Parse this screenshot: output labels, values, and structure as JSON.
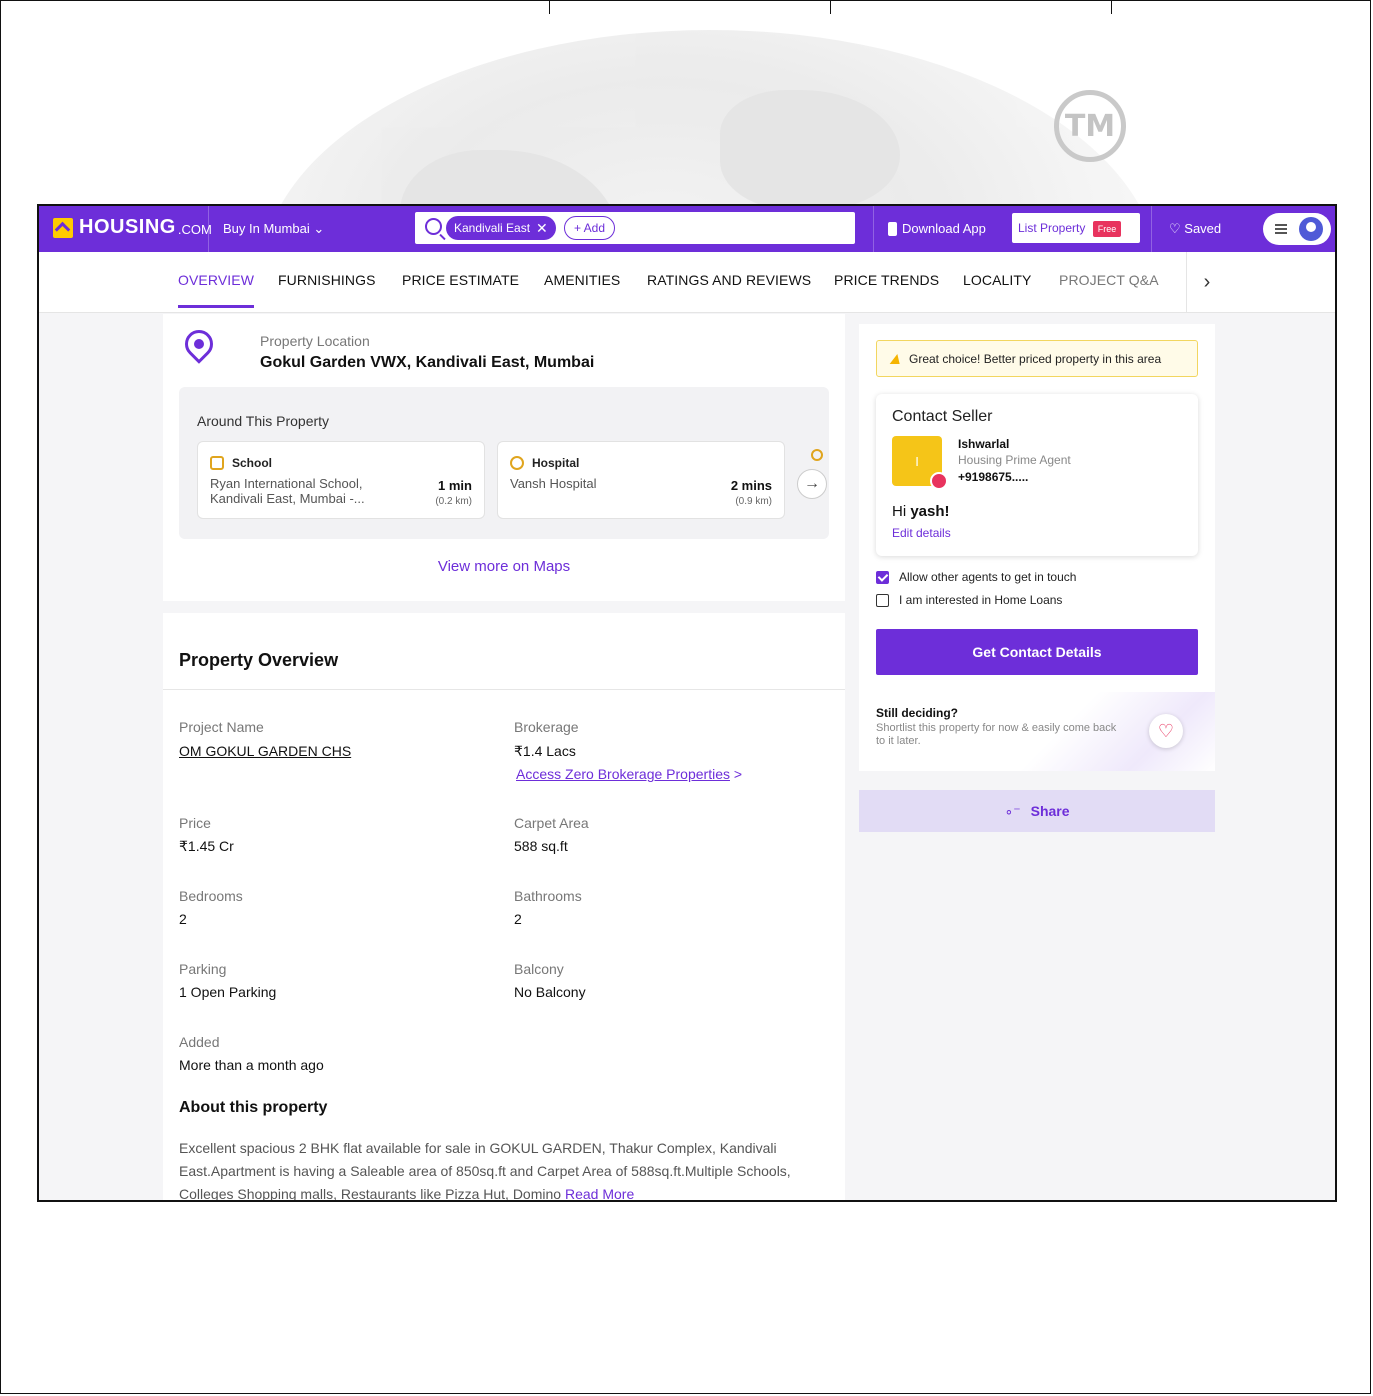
{
  "header": {
    "logo_text": "HOUSING",
    "logo_suffix": ".COM",
    "buy_menu": "Buy In Mumbai",
    "search_chip": "Kandivali East",
    "search_add": "+ Add",
    "download_app": "Download App",
    "list_property": "List Property",
    "free_badge": "Free",
    "saved": "Saved",
    "brand_color": "#6d2ed9"
  },
  "watermark": {
    "tm": "TM"
  },
  "tabs": [
    {
      "label": "OVERVIEW",
      "active": true
    },
    {
      "label": "FURNISHINGS"
    },
    {
      "label": "PRICE ESTIMATE"
    },
    {
      "label": "AMENITIES"
    },
    {
      "label": "RATINGS AND REVIEWS"
    },
    {
      "label": "PRICE TRENDS"
    },
    {
      "label": "LOCALITY"
    },
    {
      "label": "PROJECT Q&A"
    }
  ],
  "location": {
    "label": "Property Location",
    "value": "Gokul Garden VWX, Kandivali East, Mumbai"
  },
  "around": {
    "title": "Around This Property",
    "items": [
      {
        "type": "School",
        "name": "Ryan International School, Kandivali East, Mumbai -...",
        "time": "1 min",
        "distance": "(0.2 km)"
      },
      {
        "type": "Hospital",
        "name": "Vansh Hospital",
        "time": "2 mins",
        "distance": "(0.9 km)"
      }
    ],
    "maps_link": "View more on Maps"
  },
  "overview": {
    "title": "Property Overview",
    "fields": {
      "project_name_label": "Project Name",
      "project_name": "OM GOKUL GARDEN CHS",
      "brokerage_label": "Brokerage",
      "brokerage": "₹1.4 Lacs",
      "zero_brokerage_link": "Access Zero Brokerage Properties",
      "price_label": "Price",
      "price": "₹1.45 Cr",
      "carpet_label": "Carpet Area",
      "carpet": "588 sq.ft",
      "bedrooms_label": "Bedrooms",
      "bedrooms": "2",
      "bathrooms_label": "Bathrooms",
      "bathrooms": "2",
      "parking_label": "Parking",
      "parking": "1 Open Parking",
      "balcony_label": "Balcony",
      "balcony": "No Balcony",
      "added_label": "Added",
      "added": "More than a month ago"
    },
    "about_title": "About this property",
    "about_text": "Excellent spacious 2 BHK flat available for sale in GOKUL GARDEN, Thakur Complex, Kandivali East.Apartment is having a Saleable area of 850sq.ft and Carpet Area of 588sq.ft.Multiple Schools, Colleges Shopping malls, Restaurants like Pizza Hut, Domino",
    "read_more": "Read More"
  },
  "contact": {
    "great_choice": "Great choice! Better priced property in this area",
    "title": "Contact Seller",
    "avatar_initial": "I",
    "seller_name": "Ishwarlal",
    "seller_role": "Housing Prime Agent",
    "seller_phone": "+9198675.....",
    "greeting_prefix": "Hi",
    "greeting_name": "yash!",
    "edit_details": "Edit details",
    "allow_agents": "Allow other agents to get in touch",
    "home_loans": "I am interested in Home Loans",
    "cta": "Get Contact Details",
    "still_deciding": "Still deciding?",
    "still_text": "Shortlist this property for now & easily come back to it later.",
    "share": "Share"
  }
}
